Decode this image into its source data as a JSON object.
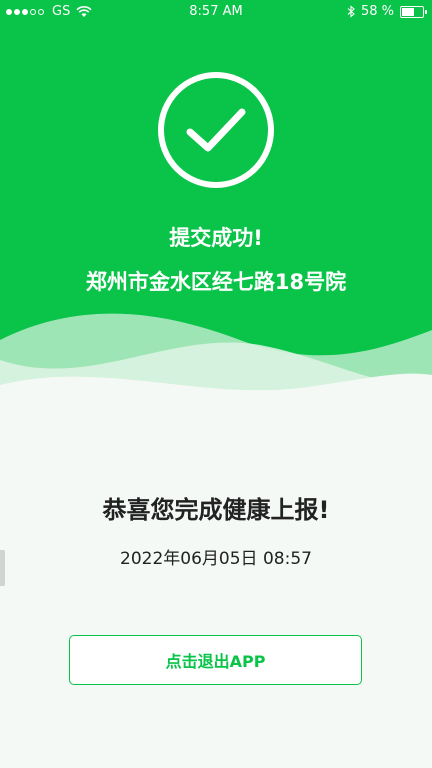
{
  "status_bar": {
    "carrier": "GS",
    "time": "8:57 AM",
    "battery_text": "58 %",
    "battery_level": 0.58,
    "signal_bars_filled": 3,
    "signal_bars_total": 5
  },
  "result": {
    "icon": "checkmark-circle-icon",
    "title": "提交成功!",
    "address": "郑州市金水区经七路18号院"
  },
  "main": {
    "congrats": "恭喜您完成健康上报!",
    "datetime": "2022年06月05日  08:57",
    "exit_button_label": "点击退出APP"
  },
  "colors": {
    "brand_green": "#0ac449",
    "background": "#f4f9f6",
    "text_dark": "#222222"
  }
}
